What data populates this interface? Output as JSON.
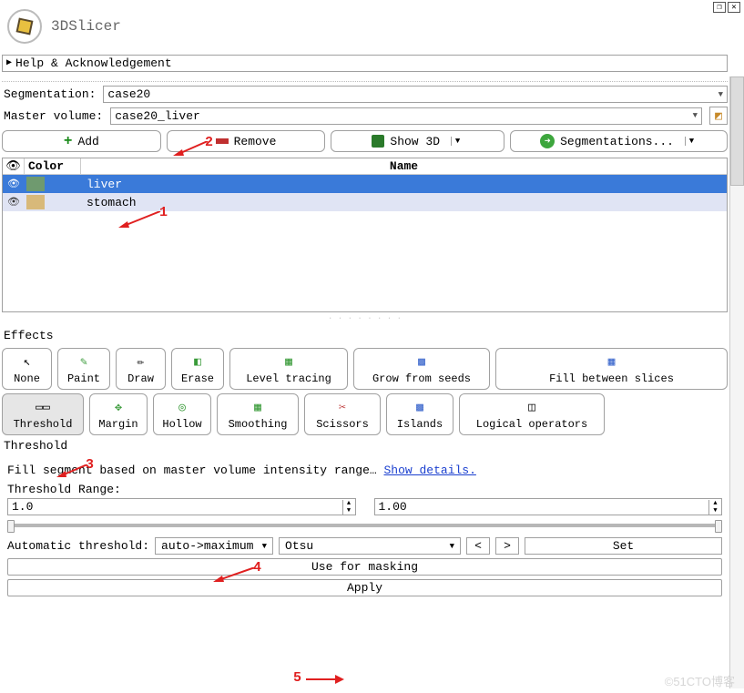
{
  "app": {
    "title": "3DSlicer"
  },
  "help_panel": {
    "title": "Help & Acknowledgement"
  },
  "segmentation": {
    "label": "Segmentation:",
    "value": "case20"
  },
  "master_volume": {
    "label": "Master volume:",
    "value": "case20_liver"
  },
  "toolbar": {
    "add": "Add",
    "remove": "Remove",
    "show3d": "Show 3D",
    "segmentations": "Segmentations..."
  },
  "segments_table": {
    "header": {
      "color": "Color",
      "name": "Name"
    },
    "rows": [
      {
        "name": "liver",
        "swatch": "liver",
        "selected": true
      },
      {
        "name": "stomach",
        "swatch": "stomach",
        "selected": false
      }
    ]
  },
  "effects": {
    "title": "Effects",
    "buttons": [
      {
        "id": "none",
        "label": "None"
      },
      {
        "id": "paint",
        "label": "Paint"
      },
      {
        "id": "draw",
        "label": "Draw"
      },
      {
        "id": "erase",
        "label": "Erase"
      },
      {
        "id": "level",
        "label": "Level tracing"
      },
      {
        "id": "grow",
        "label": "Grow from seeds"
      },
      {
        "id": "fill",
        "label": "Fill between slices"
      },
      {
        "id": "threshold",
        "label": "Threshold"
      },
      {
        "id": "margin",
        "label": "Margin"
      },
      {
        "id": "hollow",
        "label": "Hollow"
      },
      {
        "id": "smoothing",
        "label": "Smoothing"
      },
      {
        "id": "scissors",
        "label": "Scissors"
      },
      {
        "id": "islands",
        "label": "Islands"
      },
      {
        "id": "logical",
        "label": "Logical operators"
      }
    ]
  },
  "threshold": {
    "title": "Threshold",
    "description": "Fill segment based on master volume intensity range…",
    "show_details": "Show details.",
    "range_label": "Threshold Range:",
    "low": "1.0",
    "high": "1.00",
    "auto_label": "Automatic threshold:",
    "auto_mode": "auto->maximum",
    "auto_method": "Otsu",
    "prev": "<",
    "next": ">",
    "set": "Set",
    "use_masking": "Use for masking",
    "apply": "Apply"
  },
  "annotations": {
    "a1": "1",
    "a2": "2",
    "a3": "3",
    "a4": "4",
    "a5": "5"
  },
  "watermark": "©51CTO博客"
}
